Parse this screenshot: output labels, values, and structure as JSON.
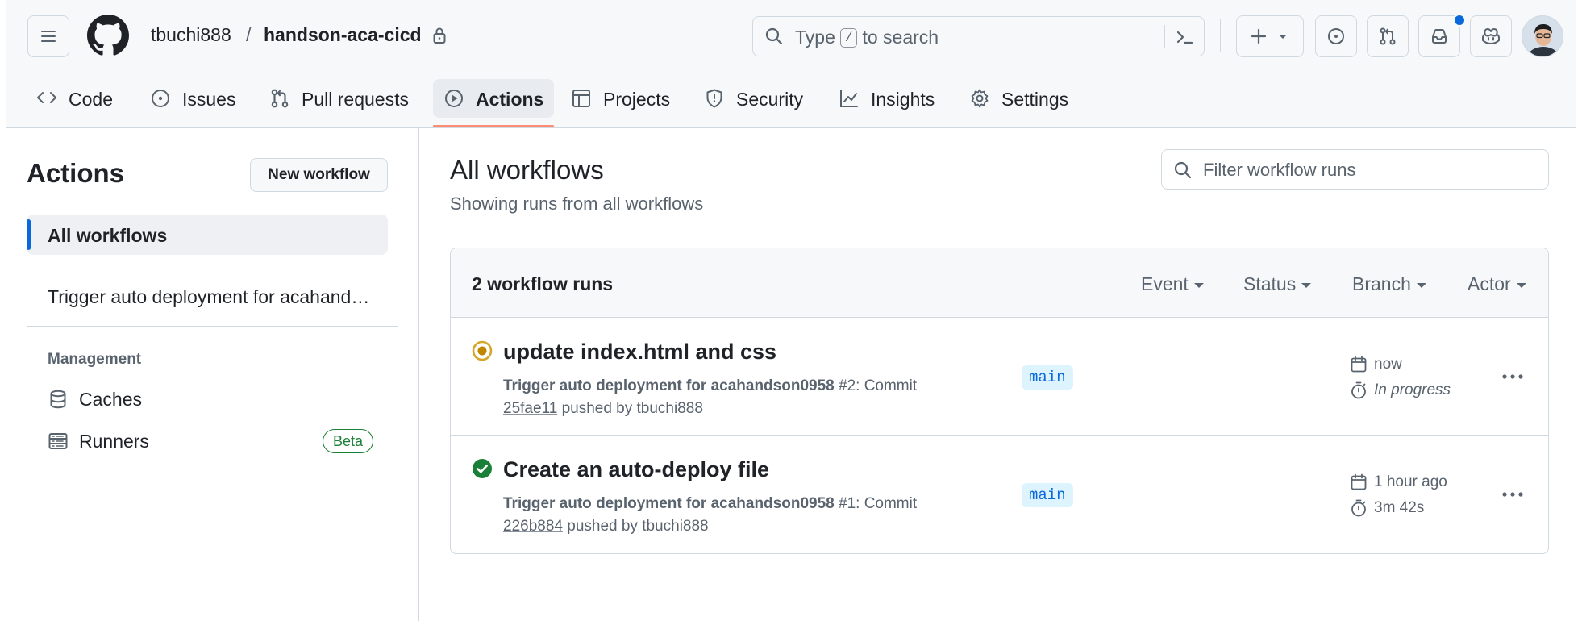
{
  "header": {
    "owner": "tbuchi888",
    "separator": "/",
    "repo": "handson-aca-cicd",
    "search": {
      "prefix": "Type",
      "key": "/",
      "suffix": "to search"
    }
  },
  "tabs": [
    {
      "label": "Code",
      "icon": "code-icon"
    },
    {
      "label": "Issues",
      "icon": "issue-opened-icon"
    },
    {
      "label": "Pull requests",
      "icon": "git-pull-request-icon"
    },
    {
      "label": "Actions",
      "icon": "play-icon",
      "active": true
    },
    {
      "label": "Projects",
      "icon": "table-icon"
    },
    {
      "label": "Security",
      "icon": "shield-icon"
    },
    {
      "label": "Insights",
      "icon": "graph-icon"
    },
    {
      "label": "Settings",
      "icon": "gear-icon"
    }
  ],
  "sidebar": {
    "title": "Actions",
    "new_workflow": "New workflow",
    "all_workflows": "All workflows",
    "workflows": [
      "Trigger auto deployment for acahandson0958"
    ],
    "management_label": "Management",
    "items": [
      {
        "label": "Caches",
        "icon": "database-icon"
      },
      {
        "label": "Runners",
        "icon": "server-icon",
        "badge": "Beta"
      }
    ]
  },
  "main": {
    "title": "All workflows",
    "subtitle": "Showing runs from all workflows",
    "filter_placeholder": "Filter workflow runs",
    "runs_count": "2 workflow runs",
    "filters": [
      "Event",
      "Status",
      "Branch",
      "Actor"
    ],
    "runs": [
      {
        "title": "update index.html and css",
        "workflow": "Trigger auto deployment for acahandson0958",
        "run_number": "#2: Commit",
        "sha": "25fae11",
        "pushed_by": "pushed by tbuchi888",
        "branch": "main",
        "time": "now",
        "duration": "In progress",
        "status": "in-progress",
        "status_color": "#bf8700"
      },
      {
        "title": "Create an auto-deploy file",
        "workflow": "Trigger auto deployment for acahandson0958",
        "run_number": "#1: Commit",
        "sha": "226b884",
        "pushed_by": "pushed by tbuchi888",
        "branch": "main",
        "time": "1 hour ago",
        "duration": "3m 42s",
        "status": "success",
        "status_color": "#1a7f37"
      }
    ]
  },
  "colors": {
    "accent": "#0969da",
    "tab_underline": "#fd8c73",
    "success": "#1a7f37",
    "in_progress": "#bf8700"
  }
}
